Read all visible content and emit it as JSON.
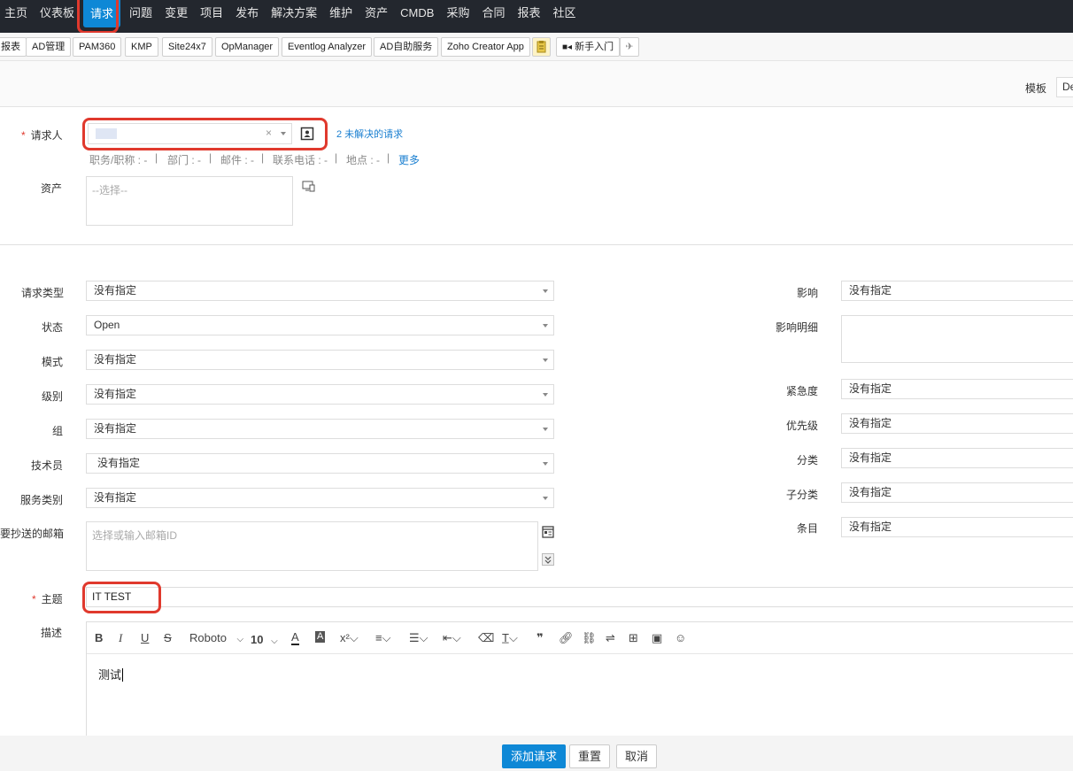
{
  "nav": {
    "items": [
      "主页",
      "仪表板",
      "请求",
      "问题",
      "变更",
      "项目",
      "发布",
      "解决方案",
      "维护",
      "资产",
      "CMDB",
      "采购",
      "合同",
      "报表",
      "社区"
    ],
    "active_index": 2
  },
  "toolbar": {
    "buttons": [
      "报表",
      "AD管理",
      "PAM360",
      "KMP",
      "Site24x7",
      "OpManager",
      "Eventlog Analyzer",
      "AD自助服务",
      "Zoho Creator App"
    ],
    "new_user_guide": "新手入门"
  },
  "template": {
    "label": "模板",
    "value": "De"
  },
  "requester": {
    "label": "请求人",
    "unresolved_link": "2 未解决的请求",
    "details": [
      "职务/职称 : -",
      "部门 : -",
      "邮件 : -",
      "联系电话 : -",
      "地点 : -"
    ],
    "more_link": "更多"
  },
  "asset": {
    "label": "资产",
    "placeholder": "--选择--"
  },
  "left_fields": [
    {
      "label": "请求类型",
      "value": "没有指定"
    },
    {
      "label": "状态",
      "value": "Open"
    },
    {
      "label": "模式",
      "value": "没有指定"
    },
    {
      "label": "级别",
      "value": "没有指定"
    },
    {
      "label": "组",
      "value": "没有指定"
    },
    {
      "label": "技术员",
      "value": "没有指定"
    },
    {
      "label": "服务类别",
      "value": "没有指定"
    }
  ],
  "cc": {
    "label": "要抄送的邮箱",
    "placeholder": "选择或输入邮箱ID"
  },
  "right_fields": {
    "impact": {
      "label": "影响",
      "value": "没有指定"
    },
    "impact_detail": {
      "label": "影响明细"
    },
    "urgency": {
      "label": "紧急度",
      "value": "没有指定"
    },
    "priority": {
      "label": "优先级",
      "value": "没有指定"
    },
    "category": {
      "label": "分类",
      "value": "没有指定"
    },
    "subcategory": {
      "label": "子分类",
      "value": "没有指定"
    },
    "item": {
      "label": "条目",
      "value": "没有指定"
    }
  },
  "subject": {
    "label": "主题",
    "value": "IT TEST"
  },
  "description": {
    "label": "描述",
    "font": "Roboto",
    "font_size": "10",
    "body": "测试"
  },
  "footer": {
    "add": "添加请求",
    "reset": "重置",
    "cancel": "取消"
  },
  "colors": {
    "accent": "#0e88d6",
    "highlight": "#e0392d",
    "nav_bg": "#23272e"
  }
}
